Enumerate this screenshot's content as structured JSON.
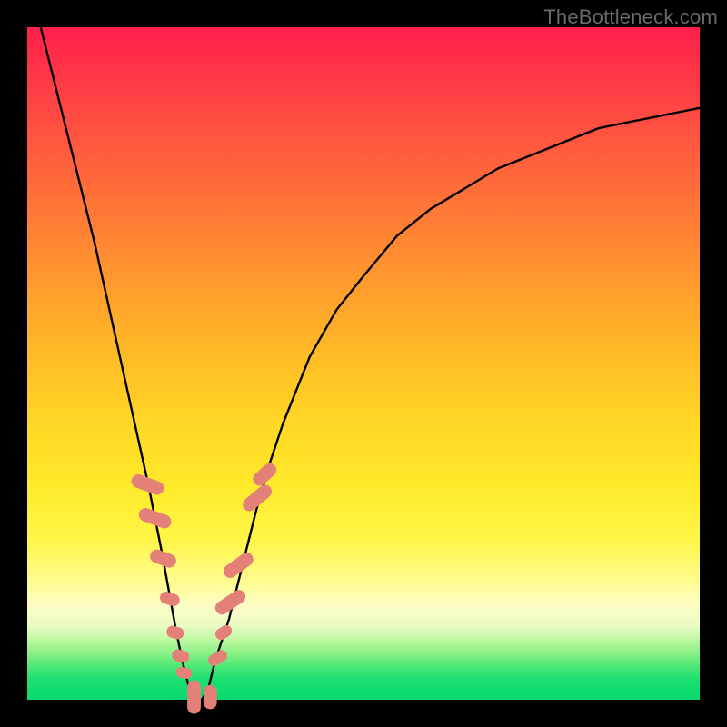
{
  "watermark": "TheBottleneck.com",
  "chart_data": {
    "type": "line",
    "title": "",
    "xlabel": "",
    "ylabel": "",
    "xlim": [
      0,
      100
    ],
    "ylim": [
      0,
      100
    ],
    "grid": false,
    "legend": false,
    "series": [
      {
        "name": "bottleneck-curve",
        "color": "#000000",
        "x": [
          2,
          4,
          6,
          8,
          10,
          12,
          14,
          16,
          18,
          20,
          22,
          23,
          24,
          25,
          26,
          27,
          28,
          30,
          32,
          34,
          36,
          38,
          42,
          46,
          50,
          55,
          60,
          65,
          70,
          75,
          80,
          85,
          90,
          95,
          100
        ],
        "y": [
          100,
          92,
          84,
          76,
          68,
          59,
          50,
          41,
          32,
          22,
          11,
          6,
          2,
          0,
          0,
          2,
          6,
          12,
          20,
          28,
          35,
          41,
          51,
          58,
          63,
          69,
          73,
          76,
          79,
          81,
          83,
          85,
          86,
          87,
          88
        ]
      }
    ],
    "markers": [
      {
        "name": "curve-dots",
        "color": "#e38077",
        "shape": "round-rect",
        "points": [
          {
            "x": 17.9,
            "y": 32,
            "w": 2.0,
            "h": 5.0,
            "rot": -70
          },
          {
            "x": 19.0,
            "y": 27,
            "w": 2.0,
            "h": 5.0,
            "rot": -70
          },
          {
            "x": 20.2,
            "y": 21,
            "w": 2.0,
            "h": 4.0,
            "rot": -70
          },
          {
            "x": 21.2,
            "y": 15,
            "w": 1.8,
            "h": 3.0,
            "rot": -72
          },
          {
            "x": 22.0,
            "y": 10,
            "w": 1.8,
            "h": 2.6,
            "rot": -75
          },
          {
            "x": 22.8,
            "y": 6.5,
            "w": 1.8,
            "h": 2.6,
            "rot": -75
          },
          {
            "x": 23.3,
            "y": 4.0,
            "w": 1.6,
            "h": 2.4,
            "rot": -78
          },
          {
            "x": 24.8,
            "y": 0.4,
            "w": 2.0,
            "h": 5.0,
            "rot": 0
          },
          {
            "x": 27.2,
            "y": 0.4,
            "w": 2.0,
            "h": 3.6,
            "rot": 0
          },
          {
            "x": 28.3,
            "y": 6.2,
            "w": 1.7,
            "h": 3.0,
            "rot": 60
          },
          {
            "x": 29.2,
            "y": 10.0,
            "w": 1.7,
            "h": 2.6,
            "rot": 58
          },
          {
            "x": 30.2,
            "y": 14.5,
            "w": 2.0,
            "h": 5.0,
            "rot": 56
          },
          {
            "x": 31.4,
            "y": 20.0,
            "w": 2.0,
            "h": 5.0,
            "rot": 54
          },
          {
            "x": 34.2,
            "y": 30.0,
            "w": 2.0,
            "h": 5.0,
            "rot": 50
          },
          {
            "x": 35.3,
            "y": 33.5,
            "w": 2.0,
            "h": 4.0,
            "rot": 48
          }
        ]
      }
    ]
  }
}
